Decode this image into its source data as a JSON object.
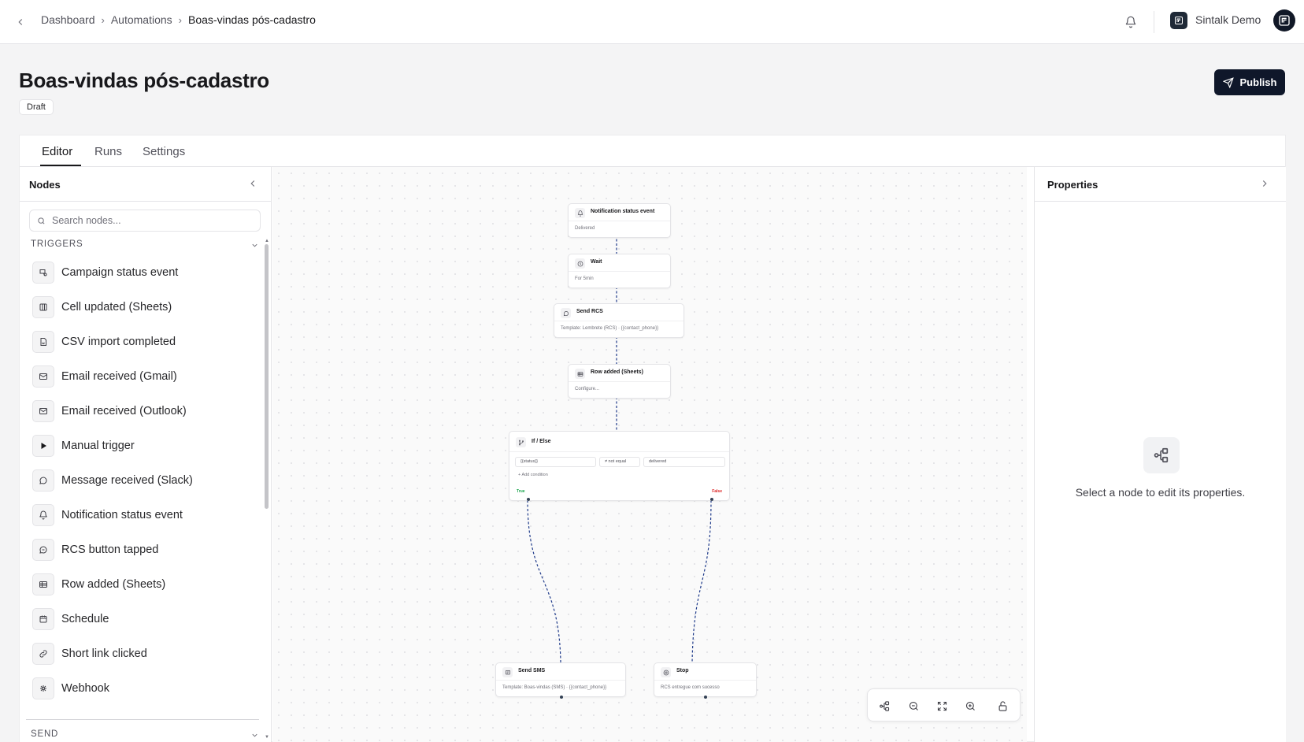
{
  "topbar": {
    "breadcrumbs": [
      "Dashboard",
      "Automations",
      "Boas-vindas pós-cadastro"
    ],
    "breadcrumb_separator": "›",
    "workspace_name": "Sintalk Demo"
  },
  "header": {
    "title": "Boas-vindas pós-cadastro",
    "status_badge": "Draft",
    "publish_label": "Publish"
  },
  "tabs": [
    {
      "label": "Editor",
      "active": true
    },
    {
      "label": "Runs",
      "active": false
    },
    {
      "label": "Settings",
      "active": false
    }
  ],
  "nodes_panel": {
    "title": "Nodes",
    "search_placeholder": "Search nodes...",
    "sections": [
      {
        "label": "TRIGGERS",
        "expanded": true,
        "items": [
          {
            "label": "Campaign status event",
            "icon": "campaign-icon"
          },
          {
            "label": "Cell updated (Sheets)",
            "icon": "columns-icon"
          },
          {
            "label": "CSV import completed",
            "icon": "csv-file-icon"
          },
          {
            "label": "Email received (Gmail)",
            "icon": "mail-icon"
          },
          {
            "label": "Email received (Outlook)",
            "icon": "mail-icon"
          },
          {
            "label": "Manual trigger",
            "icon": "play-icon"
          },
          {
            "label": "Message received (Slack)",
            "icon": "message-circle-icon"
          },
          {
            "label": "Notification status event",
            "icon": "bell-icon"
          },
          {
            "label": "RCS button tapped",
            "icon": "rcs-icon"
          },
          {
            "label": "Row added (Sheets)",
            "icon": "table-icon"
          },
          {
            "label": "Schedule",
            "icon": "calendar-icon"
          },
          {
            "label": "Short link clicked",
            "icon": "link-icon"
          },
          {
            "label": "Webhook",
            "icon": "webhook-icon"
          }
        ]
      },
      {
        "label": "SEND",
        "expanded": true
      }
    ]
  },
  "canvas": {
    "nodes": [
      {
        "title": "Notification status event",
        "subtitle": "Delivered",
        "icon": "bell-icon"
      },
      {
        "title": "Wait",
        "subtitle": "For 5min",
        "icon": "clock-icon"
      },
      {
        "title": "Send RCS",
        "subtitle": "Template: Lembrete (RCS) · {{contact_phone}}",
        "icon": "rcs-icon"
      },
      {
        "title": "Row added (Sheets)",
        "subtitle": "Configure...",
        "icon": "table-icon"
      },
      {
        "title": "If / Else",
        "icon": "branch-icon",
        "condition": {
          "field": "{{status}}",
          "operator": "≠ not equal",
          "value": "delivered"
        },
        "add_condition": "Add condition",
        "true_label": "True",
        "false_label": "False"
      },
      {
        "title": "Send SMS",
        "subtitle": "Template: Boas-vindas (SMS) · {{contact_phone}}",
        "icon": "sms-icon"
      },
      {
        "title": "Stop",
        "subtitle": "RCS entregue com sucesso",
        "icon": "stop-icon"
      }
    ],
    "edge_color": "#1e3a8a",
    "zoom_toolbar": [
      "auto-layout-icon",
      "zoom-out-icon",
      "fit-view-icon",
      "zoom-in-icon",
      "lock-icon"
    ]
  },
  "properties_panel": {
    "title": "Properties",
    "empty_message": "Select a node to edit its properties."
  }
}
